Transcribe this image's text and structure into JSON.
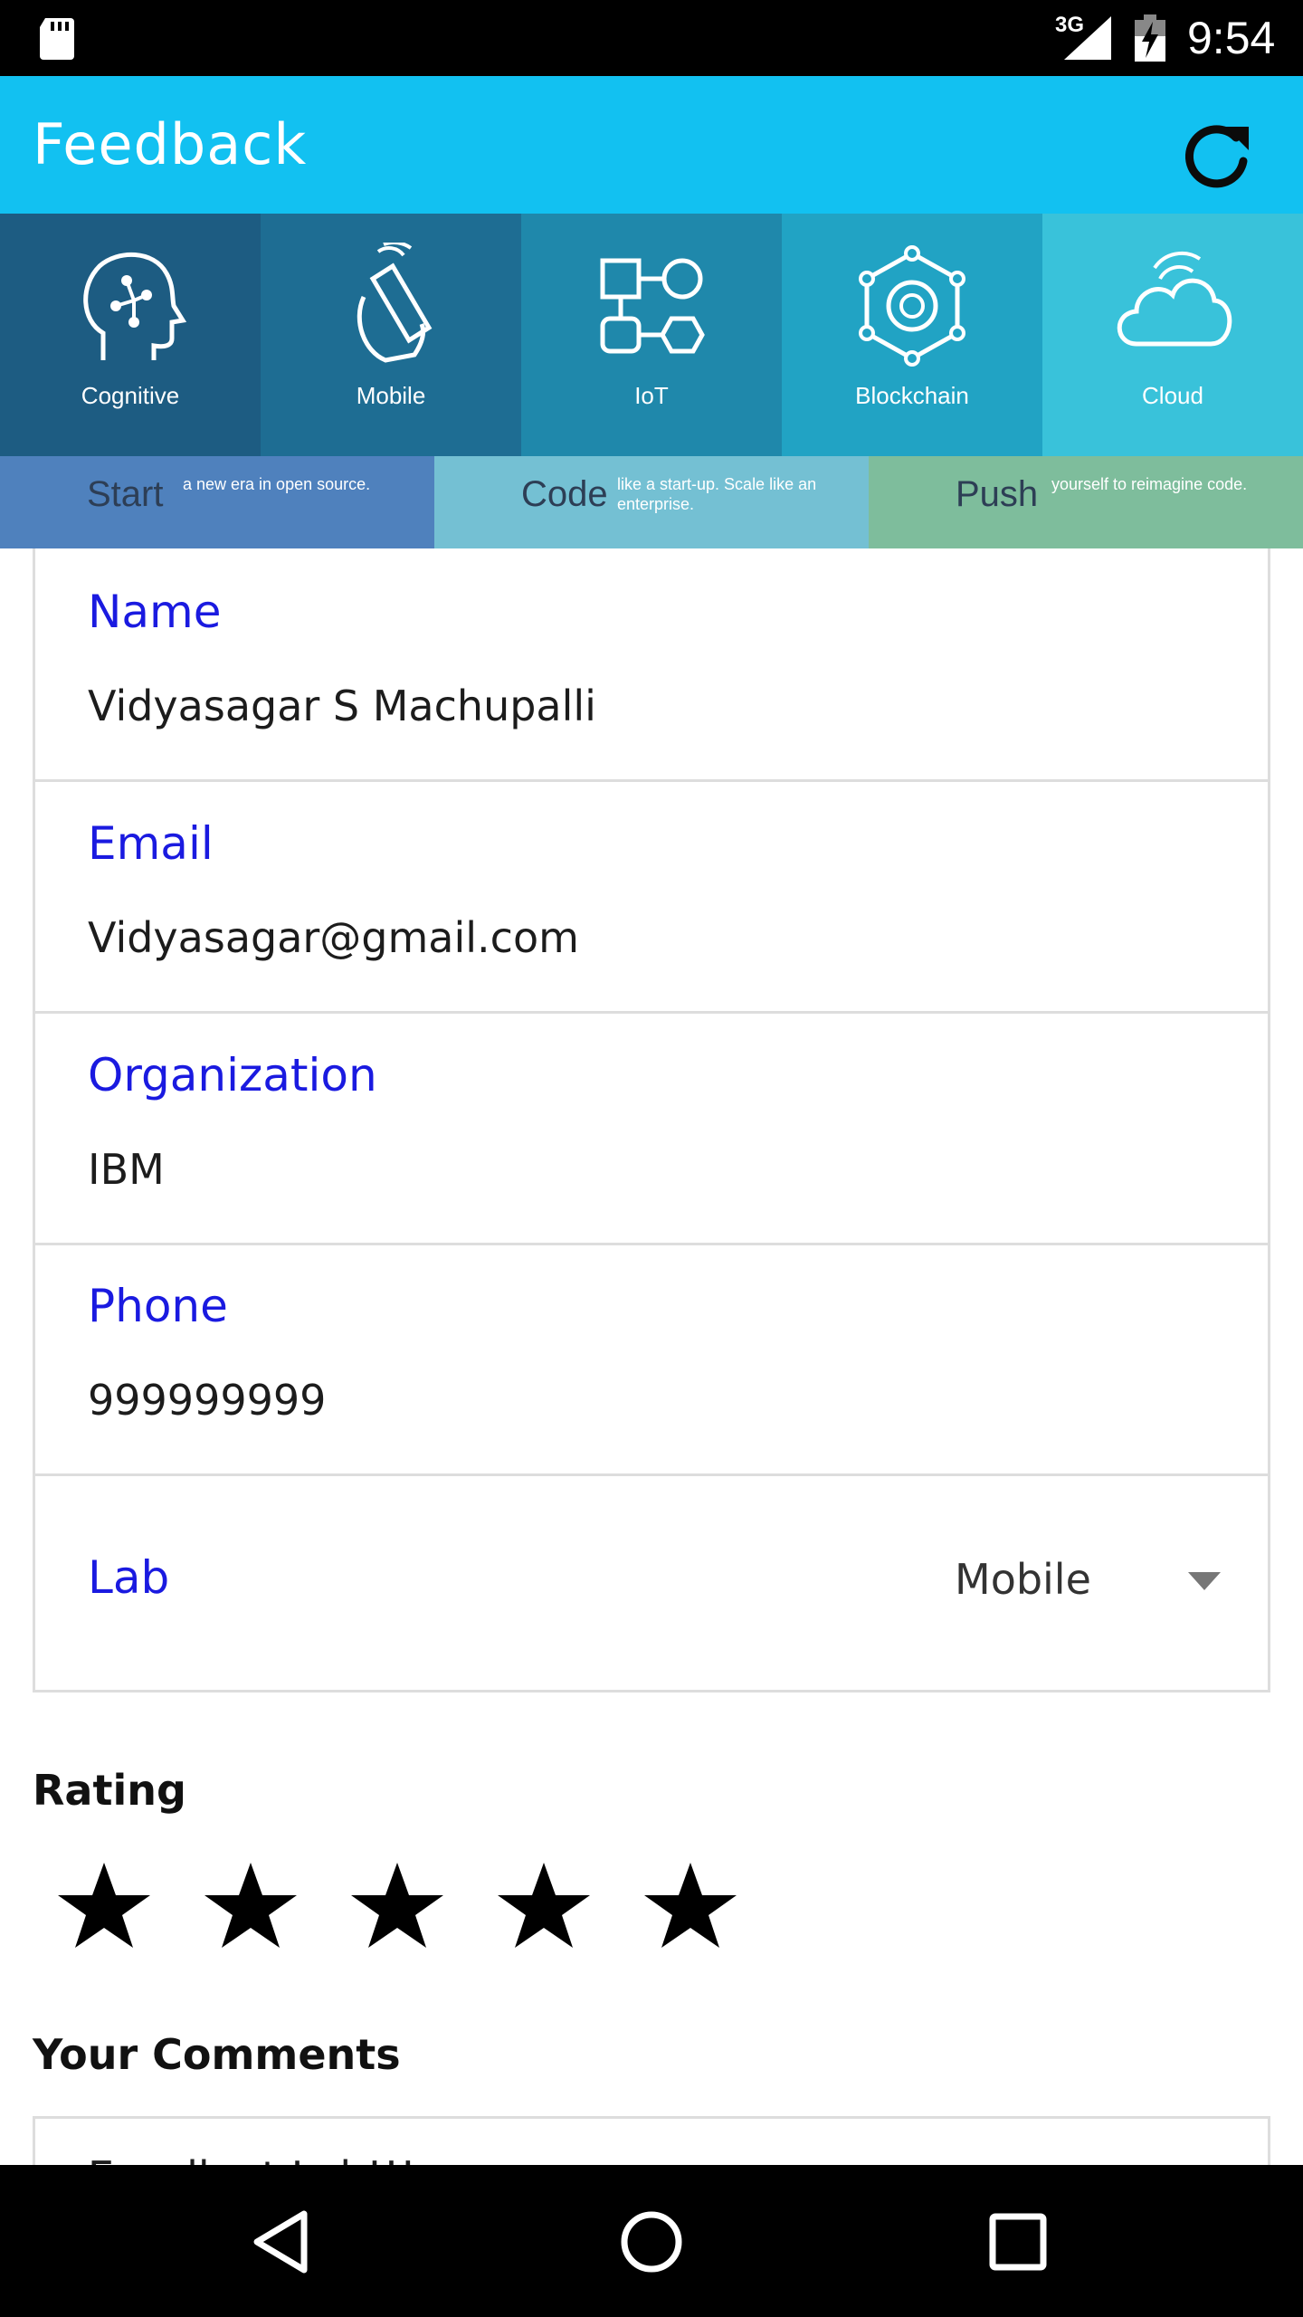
{
  "status_bar": {
    "network": "3G",
    "time": "9:54"
  },
  "app_bar": {
    "title": "Feedback",
    "refresh_icon": "refresh-icon"
  },
  "banner": {
    "tiles": [
      {
        "label": "Cognitive",
        "icon": "cognitive-head-icon",
        "color": "#1d5c82"
      },
      {
        "label": "Mobile",
        "icon": "mobile-hand-icon",
        "color": "#1e6d93"
      },
      {
        "label": "IoT",
        "icon": "iot-shapes-icon",
        "color": "#1f88ab"
      },
      {
        "label": "Blockchain",
        "icon": "blockchain-icon",
        "color": "#21a3c4"
      },
      {
        "label": "Cloud",
        "icon": "cloud-icon",
        "color": "#39c2da"
      }
    ],
    "strips": [
      {
        "big": "Start",
        "small": "a new era in open source.",
        "color": "#4f81bd"
      },
      {
        "big": "Code",
        "small": "like a start-up. Scale like an enterprise.",
        "color": "#74c0d3"
      },
      {
        "big": "Push",
        "small": "yourself to reimagine code.",
        "color": "#7ebd9c"
      }
    ]
  },
  "form": {
    "fields": [
      {
        "label": "Name",
        "value": "Vidyasagar S Machupalli"
      },
      {
        "label": "Email",
        "value": "Vidyasagar@gmail.com"
      },
      {
        "label": "Organization",
        "value": "IBM"
      },
      {
        "label": "Phone",
        "value": "999999999"
      }
    ],
    "lab": {
      "label": "Lab",
      "selected": "Mobile"
    }
  },
  "rating": {
    "title": "Rating",
    "value": 5,
    "max": 5
  },
  "comments": {
    "title": "Your Comments",
    "value": "Excellent Lab!!!"
  },
  "nav_bar": {
    "back_icon": "back-triangle-icon",
    "home_icon": "home-circle-icon",
    "recents_icon": "recents-square-icon"
  },
  "colors": {
    "app_bar": "#12c1f1",
    "label_blue": "#1a1ae0"
  }
}
